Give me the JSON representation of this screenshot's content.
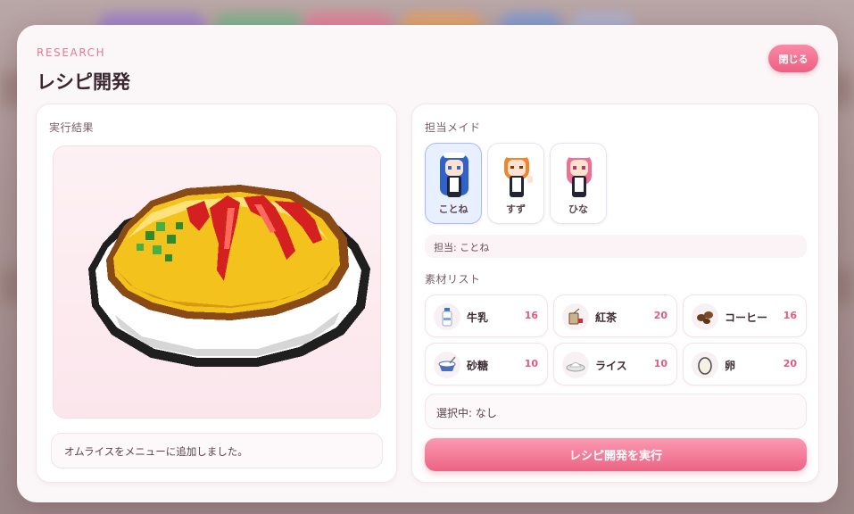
{
  "modal": {
    "eyebrow": "RESEARCH",
    "title": "レシピ開発",
    "close_label": "閉じる"
  },
  "result": {
    "label": "実行結果",
    "dish": "omurice-pixel-art",
    "message": "オムライスをメニューに追加しました。"
  },
  "maids": {
    "label": "担当メイド",
    "items": [
      {
        "name": "ことね",
        "hair": "#2f63c9",
        "selected": true
      },
      {
        "name": "すず",
        "hair": "#f0852c",
        "selected": false
      },
      {
        "name": "ひな",
        "hair": "#ef6f95",
        "selected": false
      }
    ],
    "assigned_text": "担当: ことね"
  },
  "ingredients": {
    "label": "素材リスト",
    "items": [
      {
        "name": "牛乳",
        "count": "16",
        "icon": "milk-bottle-icon"
      },
      {
        "name": "紅茶",
        "count": "20",
        "icon": "tea-bag-icon"
      },
      {
        "name": "コーヒー",
        "count": "16",
        "icon": "coffee-beans-icon"
      },
      {
        "name": "砂糖",
        "count": "10",
        "icon": "sugar-bowl-icon"
      },
      {
        "name": "ライス",
        "count": "10",
        "icon": "rice-plate-icon"
      },
      {
        "name": "卵",
        "count": "20",
        "icon": "egg-icon"
      }
    ],
    "selected_text": "選択中: なし"
  },
  "actions": {
    "execute_label": "レシピ開発を実行"
  },
  "colors": {
    "accent": "#ee5f83",
    "selected_card": "#e8efff",
    "count_text": "#e05b7e"
  }
}
